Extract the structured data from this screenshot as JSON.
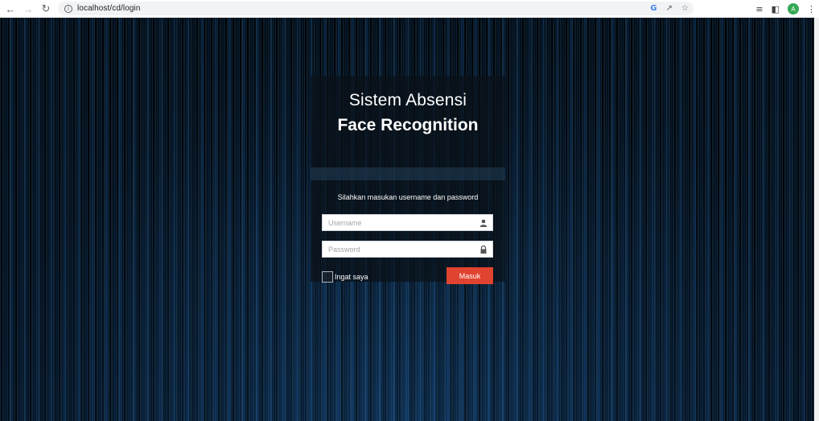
{
  "browser": {
    "url": "localhost/cd/login",
    "profile_initial": "A",
    "icons": [
      "back-icon",
      "forward-icon",
      "reload-icon",
      "info-icon",
      "google-icon",
      "share-icon",
      "star-icon",
      "reading-list-icon",
      "side-panel-icon",
      "profile-avatar",
      "menu-icon"
    ]
  },
  "login": {
    "title_line1": "Sistem Absensi",
    "title_line2": "Face Recognition",
    "subtitle": "Silahkan masukan username dan password",
    "username_placeholder": "Username",
    "password_placeholder": "Password",
    "remember_label": "Ingat saya",
    "submit_label": "Masuk"
  },
  "colors": {
    "button": "#e0432f",
    "background": "#040a12",
    "accent_lines": "#2878be"
  }
}
